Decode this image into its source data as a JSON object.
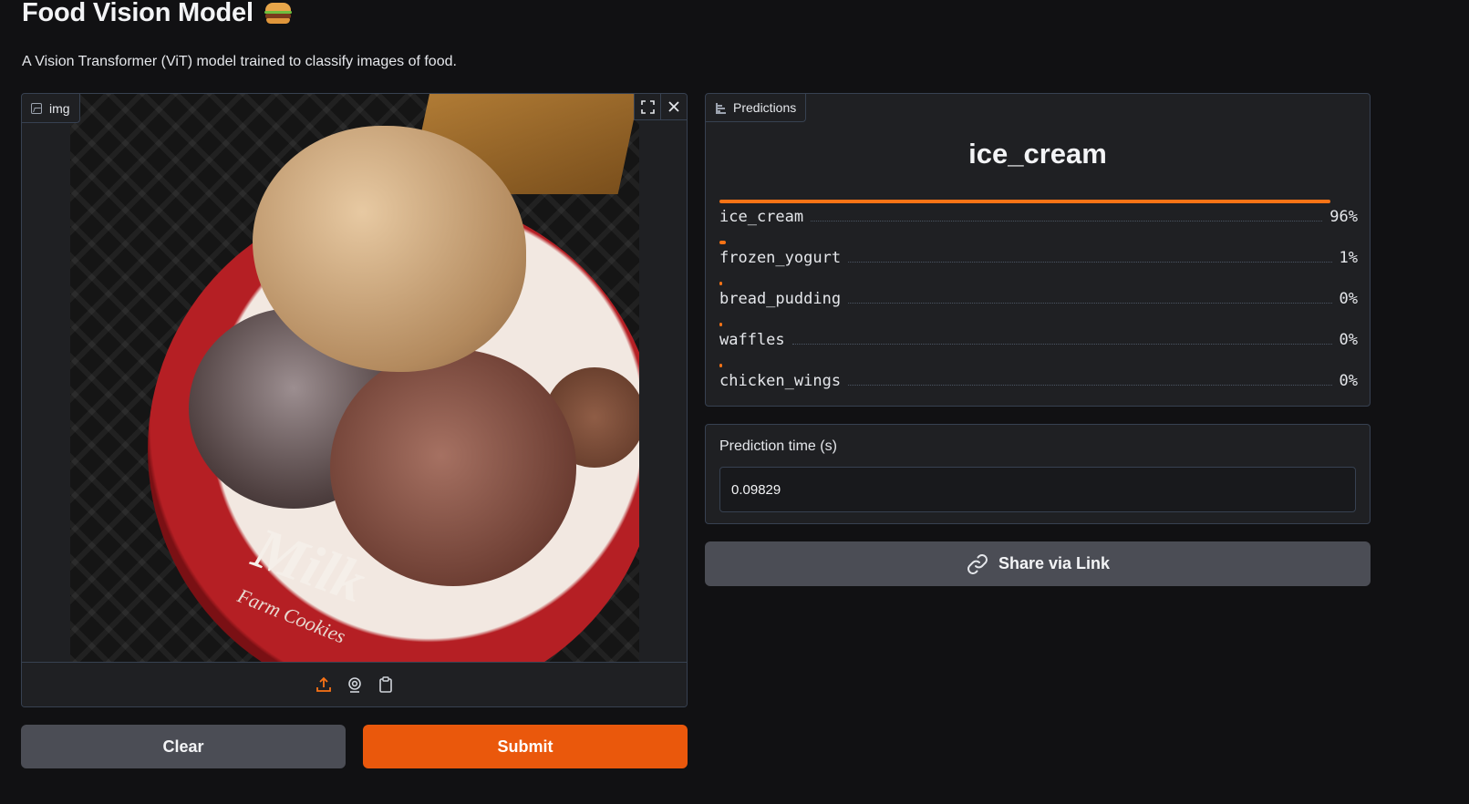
{
  "header": {
    "title": "Food Vision Model",
    "title_icon": "hamburger-emoji",
    "description": "A Vision Transformer (ViT) model trained to classify images of food."
  },
  "image_input": {
    "label": "img",
    "label_icon": "image-icon",
    "toolbar_icons": [
      "fullscreen-icon",
      "close-icon"
    ],
    "source_icons": [
      "upload-icon",
      "webcam-icon",
      "clipboard-icon"
    ],
    "photo_text": "Milk",
    "photo_subtext": "Farm Cookies"
  },
  "buttons": {
    "clear": "Clear",
    "submit": "Submit",
    "share": "Share via Link"
  },
  "predictions": {
    "label": "Predictions",
    "top_label": "ice_cream",
    "items": [
      {
        "label": "ice_cream",
        "pct": "96%",
        "confidence": 0.96
      },
      {
        "label": "frozen_yogurt",
        "pct": "1%",
        "confidence": 0.01
      },
      {
        "label": "bread_pudding",
        "pct": "0%",
        "confidence": 0.004
      },
      {
        "label": "waffles",
        "pct": "0%",
        "confidence": 0.003
      },
      {
        "label": "chicken_wings",
        "pct": "0%",
        "confidence": 0.003
      }
    ]
  },
  "prediction_time": {
    "label": "Prediction time (s)",
    "value": "0.09829"
  },
  "colors": {
    "accent": "#ea580c",
    "bar": "#f97316",
    "panel": "#1f2023",
    "border": "#374151",
    "background": "#111113"
  }
}
